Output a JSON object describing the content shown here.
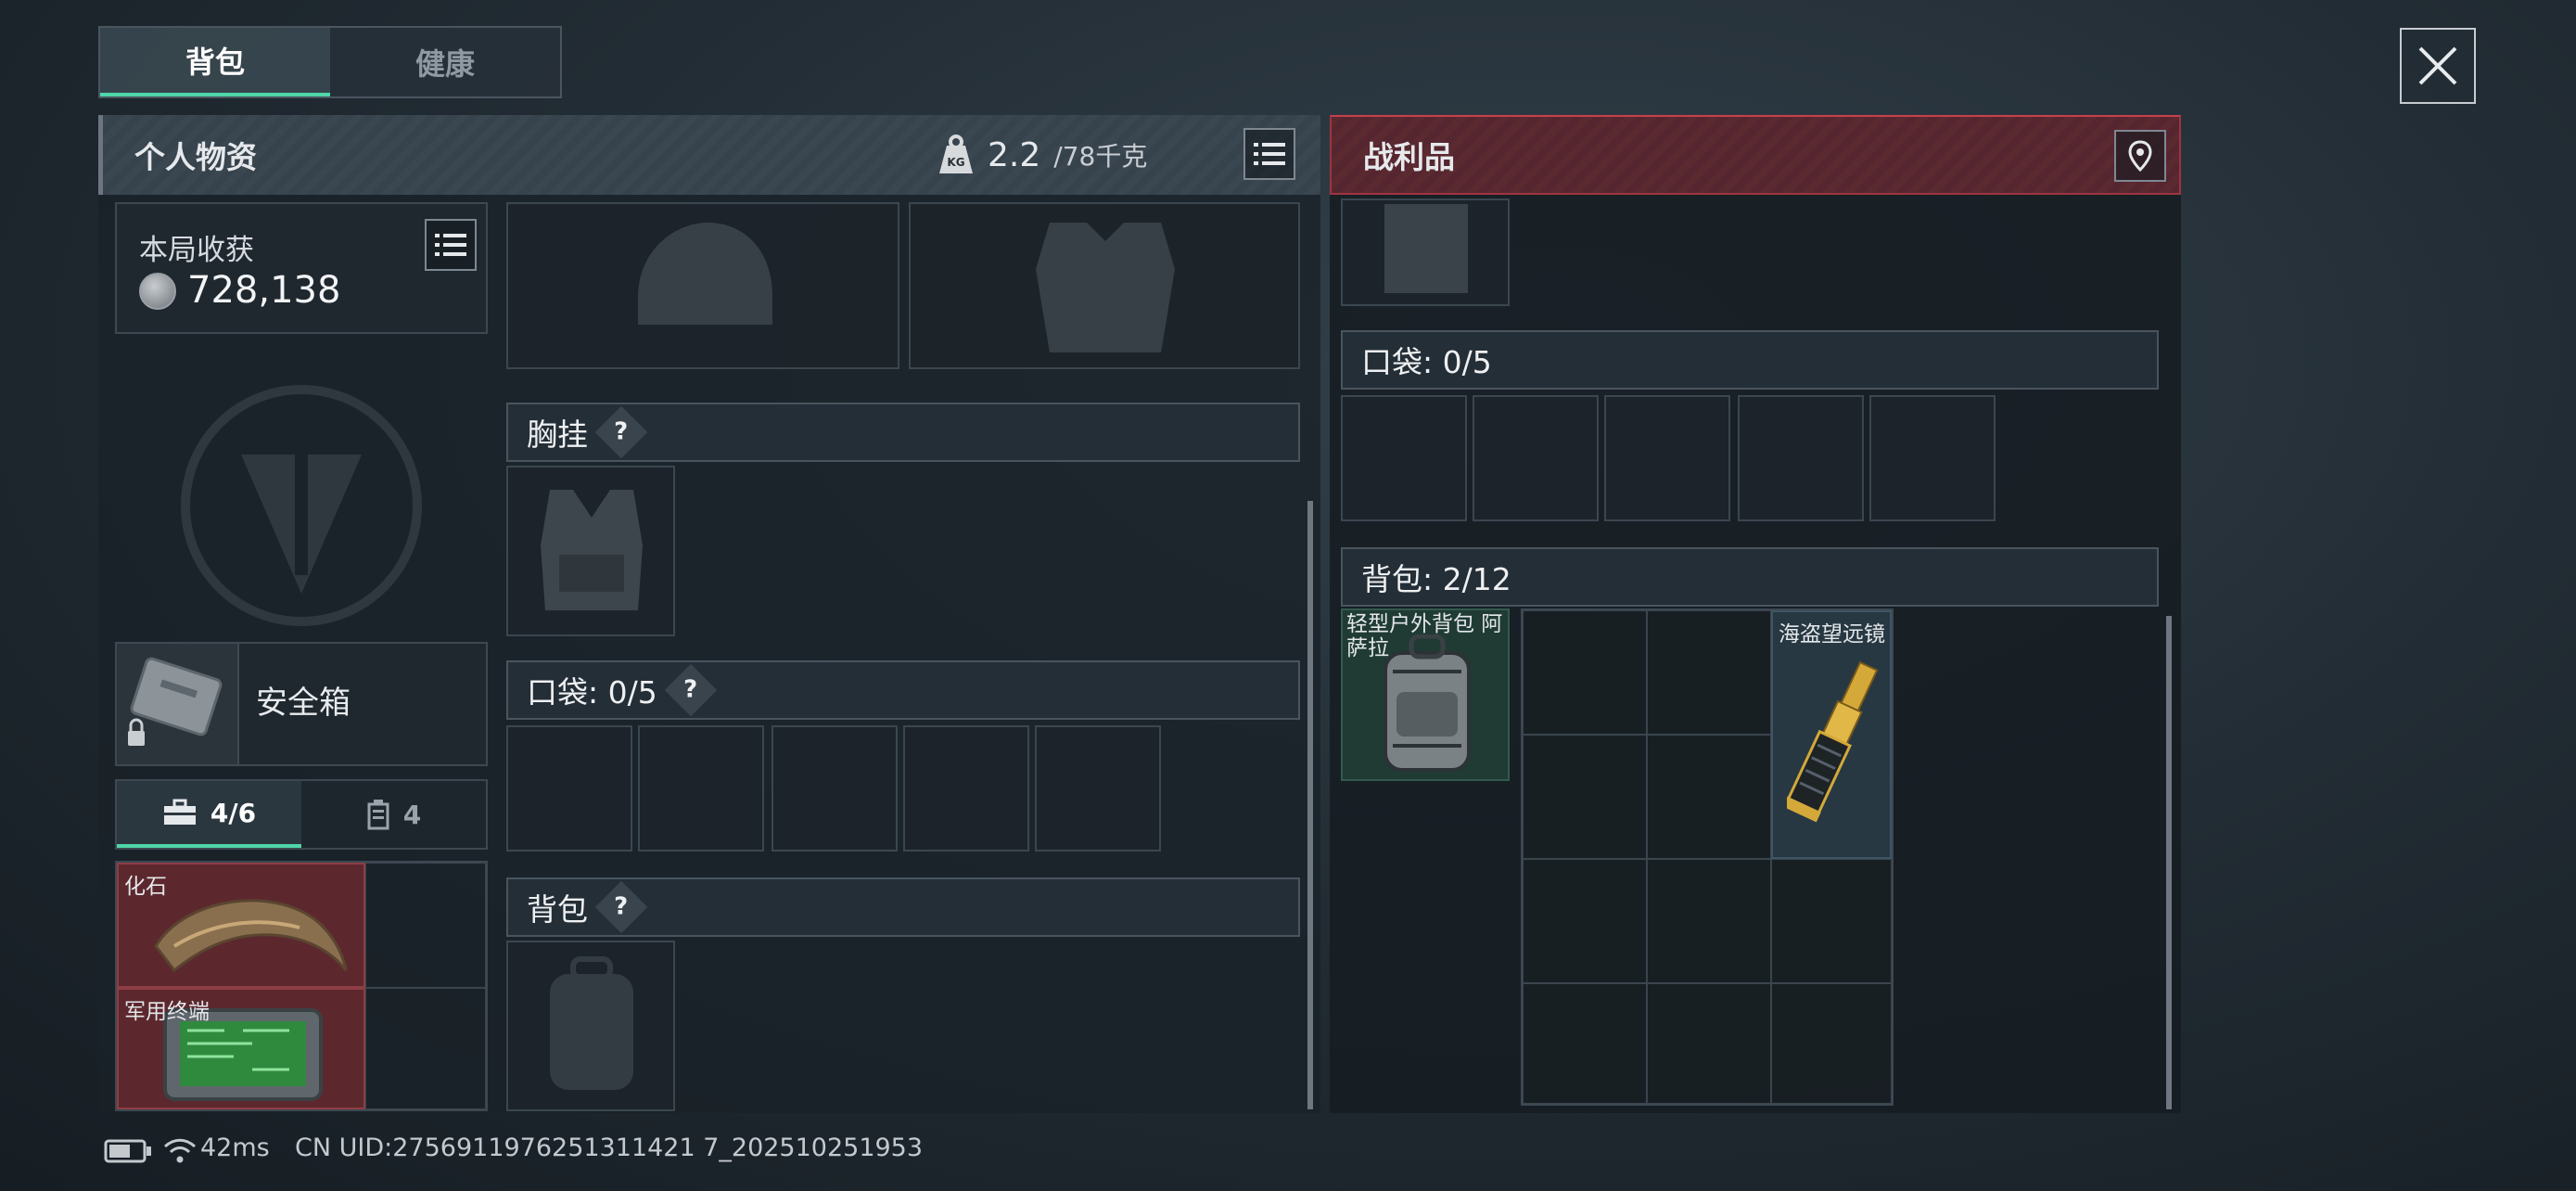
{
  "tabs": [
    {
      "label": "背包",
      "active": true
    },
    {
      "label": "健康",
      "active": false
    }
  ],
  "personal": {
    "title": "个人物资",
    "weight_value": "2.2",
    "weight_unit": "/78千克",
    "earnings_label": "本局收获",
    "earnings_value": "728,138",
    "safebox_label": "安全箱",
    "subtabs": [
      {
        "label": "4/6",
        "icon": "toolbox-icon",
        "active": true
      },
      {
        "label": "4",
        "icon": "canister-icon",
        "active": false
      }
    ],
    "safe_items": [
      {
        "label": "化石"
      },
      {
        "label": "军用终端"
      }
    ],
    "sections": {
      "chest_rig": "胸挂",
      "pockets": "口袋: 0/5",
      "backpack": "背包"
    },
    "help_mark": "?"
  },
  "loot": {
    "title": "战利品",
    "pockets": "口袋: 0/5",
    "backpack": "背包: 2/12",
    "items": [
      {
        "label": "轻型户外背包 阿萨拉"
      },
      {
        "label": "海盗望远镜"
      }
    ]
  },
  "status": {
    "ping": "42ms",
    "uid": "CN UID:2756911976251311421 7_202510251953"
  },
  "colors": {
    "accent": "#4fd6a8",
    "loot_red": "#9e3440",
    "safe_item_red": "#702a30"
  }
}
